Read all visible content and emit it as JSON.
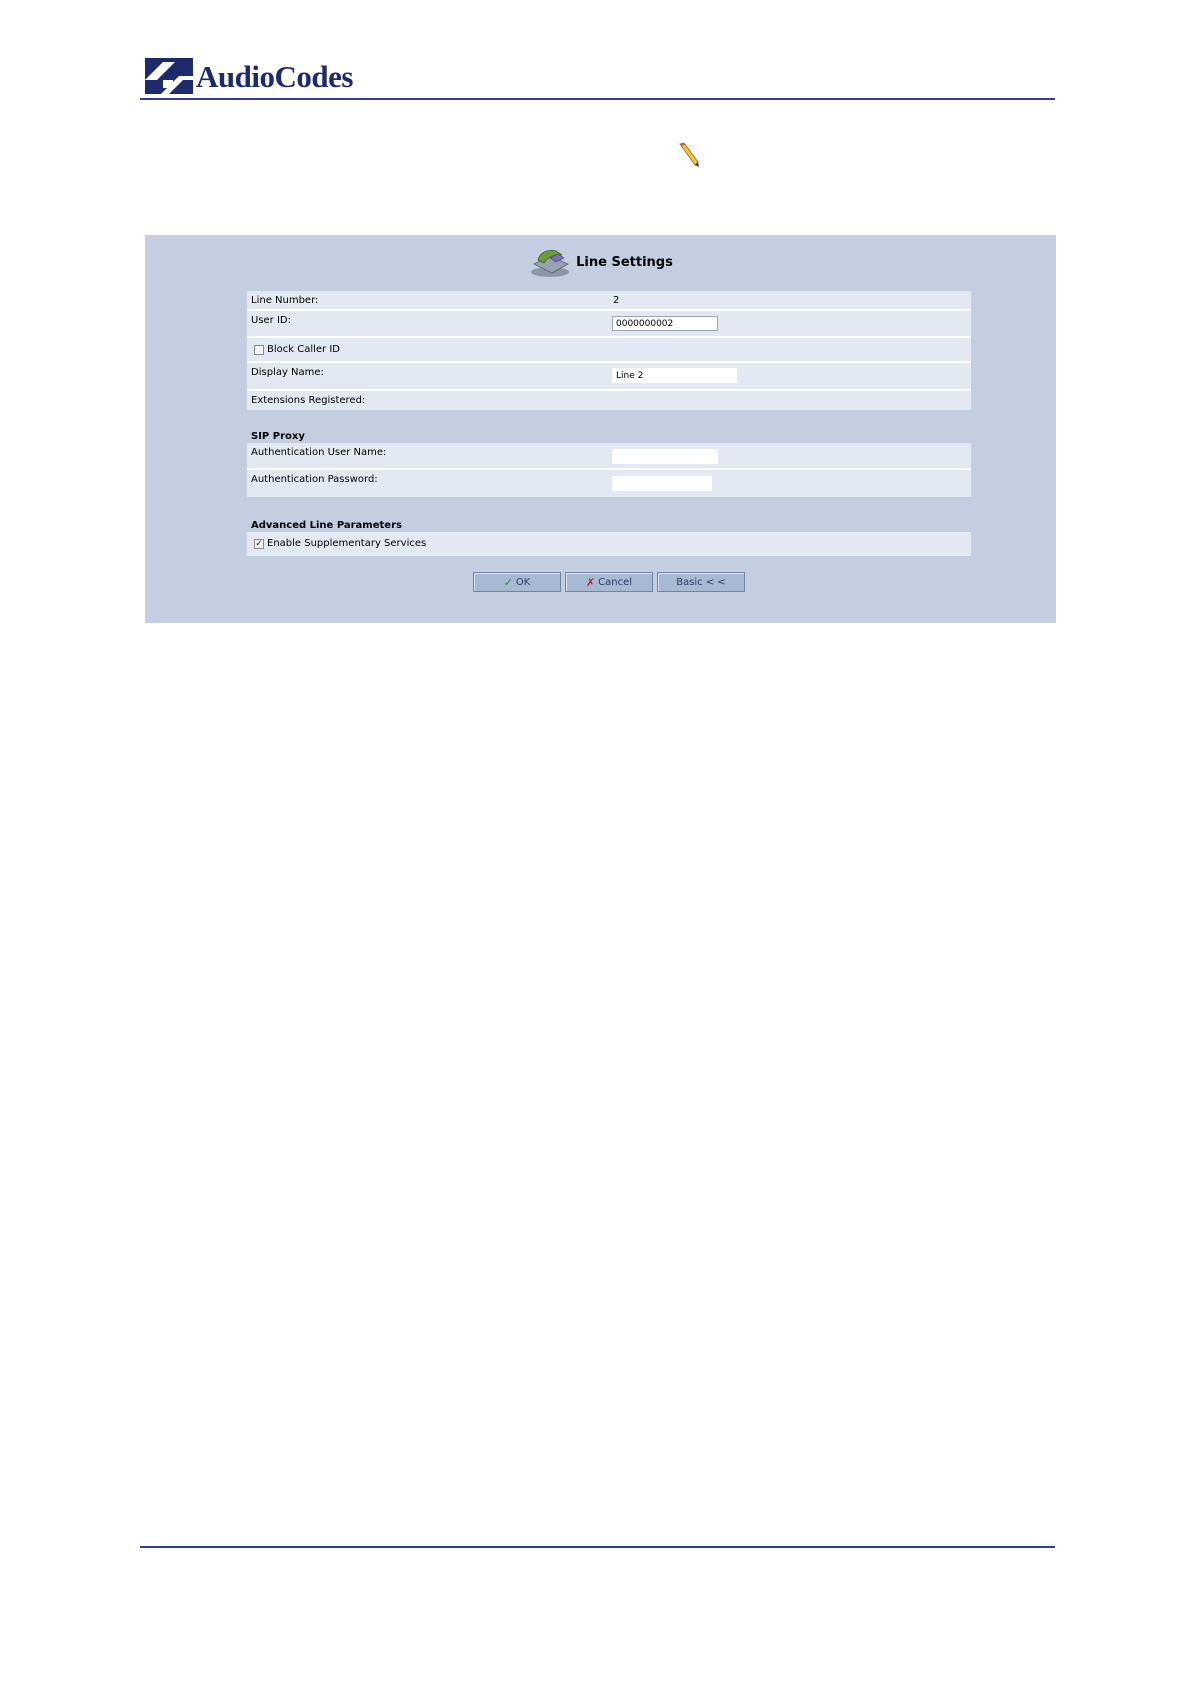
{
  "header": {
    "brand": "AudioCodes",
    "brand_color": "#1d2a6e",
    "rule_color": "#2f3f8f"
  },
  "decor": {
    "edit_icon": "pencil-icon"
  },
  "panel": {
    "title": "Line Settings",
    "title_icon": "phone-icon",
    "background": "#c3cfe1"
  },
  "form": {
    "line_number_label": "Line Number:",
    "line_number_value": "2",
    "user_id_label": "User ID:",
    "user_id_value": "0000000002",
    "block_caller_id_label": "Block Caller ID",
    "block_caller_id_checked": false,
    "display_name_label": "Display Name:",
    "display_name_value": "Line 2",
    "extensions_registered_label": "Extensions Registered:",
    "sip_proxy_heading": "SIP Proxy",
    "auth_user_label": "Authentication User Name:",
    "auth_user_value": "",
    "auth_password_label": "Authentication Password:",
    "auth_password_value": "",
    "advanced_heading": "Advanced Line Parameters",
    "supplementary_label": "Enable Supplementary Services",
    "supplementary_checked": true
  },
  "buttons": {
    "ok_label": "OK",
    "ok_icon": "checkmark-icon",
    "cancel_label": "Cancel",
    "cancel_icon": "x-icon",
    "basic_label": "Basic < <"
  }
}
